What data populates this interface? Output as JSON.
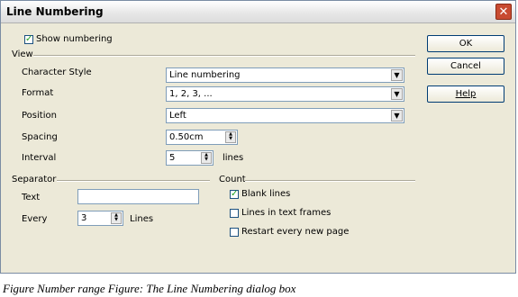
{
  "window": {
    "title": "Line Numbering",
    "close_glyph": "✕"
  },
  "show_numbering": {
    "label": "Show numbering",
    "checked": true
  },
  "view": {
    "section_title": "View",
    "character_style": {
      "label": "Character Style",
      "value": "Line numbering"
    },
    "format": {
      "label": "Format",
      "value": "1, 2, 3, ..."
    },
    "position": {
      "label": "Position",
      "value": "Left"
    },
    "spacing": {
      "label": "Spacing",
      "value": "0.50cm"
    },
    "interval": {
      "label": "Interval",
      "value": "5",
      "unit": "lines"
    }
  },
  "separator": {
    "section_title": "Separator",
    "text": {
      "label": "Text",
      "value": ""
    },
    "every": {
      "label": "Every",
      "value": "3",
      "unit": "Lines"
    }
  },
  "count": {
    "section_title": "Count",
    "blank_lines": {
      "label": "Blank lines",
      "checked": true
    },
    "lines_in_text_frames": {
      "label": "Lines in text frames",
      "checked": false
    },
    "restart_every_new_page": {
      "label": "Restart every new page",
      "checked": false
    }
  },
  "buttons": {
    "ok": "OK",
    "cancel": "Cancel",
    "help": "Help"
  },
  "caption": "Figure Number range Figure: The Line Numbering dialog box",
  "icons": {
    "dropdown": "chevron-down-icon",
    "spin": "spin-arrows-icon",
    "check": "checkmark-icon",
    "close": "close-icon"
  }
}
